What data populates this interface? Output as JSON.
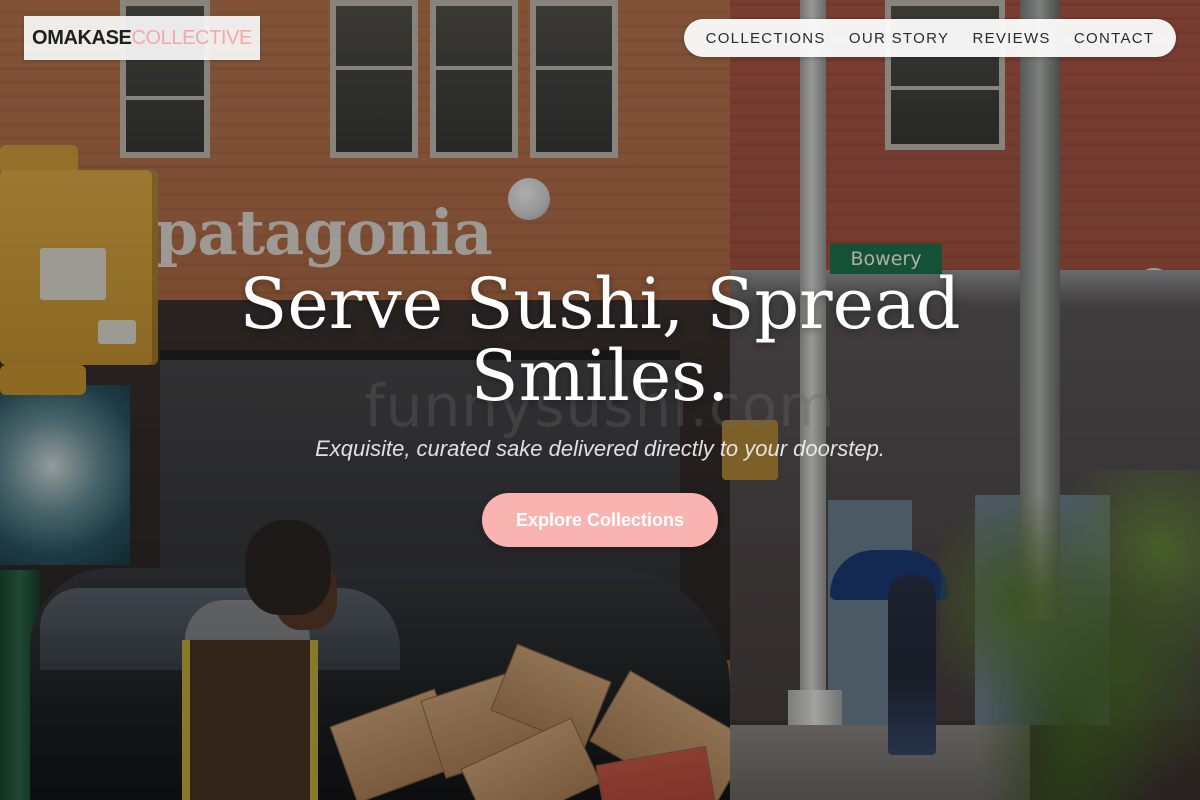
{
  "brand": {
    "name_part1": "OMAKASE",
    "name_part2": "COLLECTIVE"
  },
  "nav": {
    "items": [
      {
        "label": "COLLECTIONS"
      },
      {
        "label": "OUR STORY"
      },
      {
        "label": "REVIEWS"
      },
      {
        "label": "CONTACT"
      }
    ]
  },
  "hero": {
    "title_line1": "Serve Sushi, Spread",
    "title_line2": "Smiles.",
    "subtitle": "Exquisite, curated sake delivered directly to your doorstep.",
    "cta_label": "Explore Collections"
  },
  "background": {
    "store_sign": "patagonia",
    "street_sign": "Bowery",
    "watermark": "funnysushi.com"
  },
  "colors": {
    "accent_pink": "#f9b3b0",
    "brand_pink": "#f5a8a8",
    "nav_bg": "#fafafa",
    "dark_text": "#1f1f1f"
  }
}
